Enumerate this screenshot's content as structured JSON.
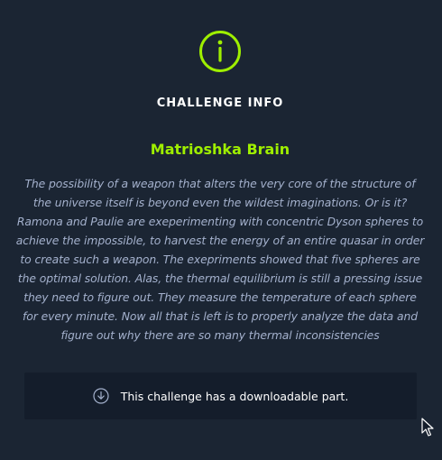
{
  "modal": {
    "icon": "info-circle-icon",
    "heading": "CHALLENGE INFO",
    "title": "Matrioshka Brain",
    "description": "The possibility of a weapon that alters the very core of the structure of the universe itself is beyond even the wildest imaginations. Or is it? Ramona and Paulie are exeperimenting with concentric Dyson spheres to achieve the impossible, to harvest the energy of an entire quasar in order to create such a weapon. The exepriments showed that five spheres are the optimal solution. Alas, the thermal equilibrium is still a pressing issue they need to figure out. They measure the temperature of each sphere for every minute. Now all that is left is to properly analyze the data and figure out why there are so many thermal inconsistencies",
    "download": {
      "icon": "download-circle-icon",
      "text": "This challenge has a downloadable part."
    }
  },
  "colors": {
    "background": "#1b2533",
    "accent": "#9fef00",
    "description_text": "#a4b1cd",
    "download_box": "#141d2b"
  },
  "cursor": "arrow-cursor-icon"
}
